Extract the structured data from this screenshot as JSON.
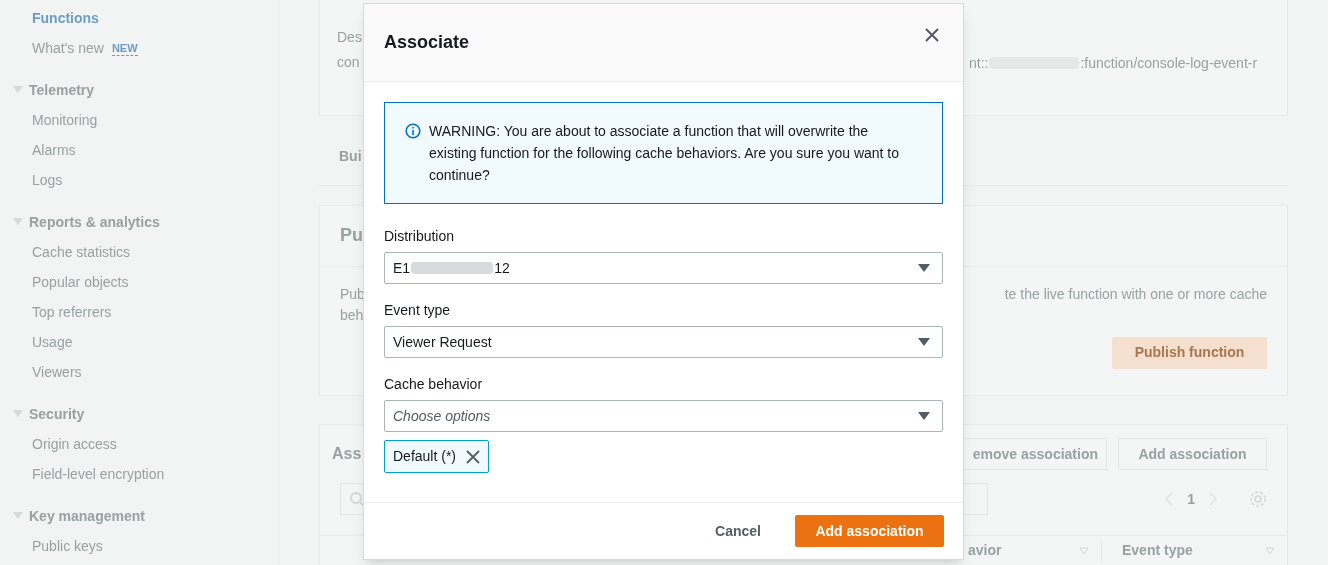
{
  "sidebar": {
    "top_items": [
      {
        "label": "Functions",
        "selected": true
      },
      {
        "label": "What's new",
        "badge": "NEW",
        "selected": false
      }
    ],
    "sections": [
      {
        "title": "Telemetry",
        "expanded": true,
        "items": [
          {
            "label": "Monitoring",
            "selected": false
          },
          {
            "label": "Alarms",
            "selected": false
          },
          {
            "label": "Logs",
            "selected": false
          }
        ]
      },
      {
        "title": "Reports & analytics",
        "expanded": true,
        "items": [
          {
            "label": "Cache statistics",
            "selected": false
          },
          {
            "label": "Popular objects",
            "selected": false
          },
          {
            "label": "Top referrers",
            "selected": false
          },
          {
            "label": "Usage",
            "selected": false
          },
          {
            "label": "Viewers",
            "selected": false
          }
        ]
      },
      {
        "title": "Security",
        "expanded": true,
        "items": [
          {
            "label": "Origin access",
            "selected": false
          },
          {
            "label": "Field-level encryption",
            "selected": false
          }
        ]
      },
      {
        "title": "Key management",
        "expanded": true,
        "items": [
          {
            "label": "Public keys",
            "selected": false
          }
        ]
      }
    ]
  },
  "details_card": {
    "left_lines": [
      "Des",
      "con"
    ],
    "arn_prefix": "nt::",
    "arn_suffix": ":function/console-log-event-r"
  },
  "tabs_card": {
    "tab": "Bui"
  },
  "publish_card": {
    "title": "Pu",
    "left_lines": [
      "Pub",
      "beh"
    ],
    "right_text": "te the live function with one or more cache",
    "button": "Publish function"
  },
  "associations_card": {
    "title": "Ass",
    "buttons": [
      "emove association",
      "Add association"
    ],
    "page": "1",
    "columns": [
      "avior",
      "Event type"
    ]
  },
  "dialog": {
    "title": "Associate",
    "warning": "WARNING: You are about to associate a function that will overwrite the existing function for the following cache behaviors. Are you sure you want to continue?",
    "fields": [
      {
        "label": "Distribution",
        "kind": "redacted",
        "value_prefix": "E1",
        "value_suffix": "12"
      },
      {
        "label": "Event type",
        "kind": "value",
        "value": "Viewer Request"
      },
      {
        "label": "Cache behavior",
        "kind": "placeholder",
        "placeholder": "Choose options"
      }
    ],
    "tokens": [
      "Default (*)"
    ],
    "cancel": "Cancel",
    "submit": "Add association"
  }
}
